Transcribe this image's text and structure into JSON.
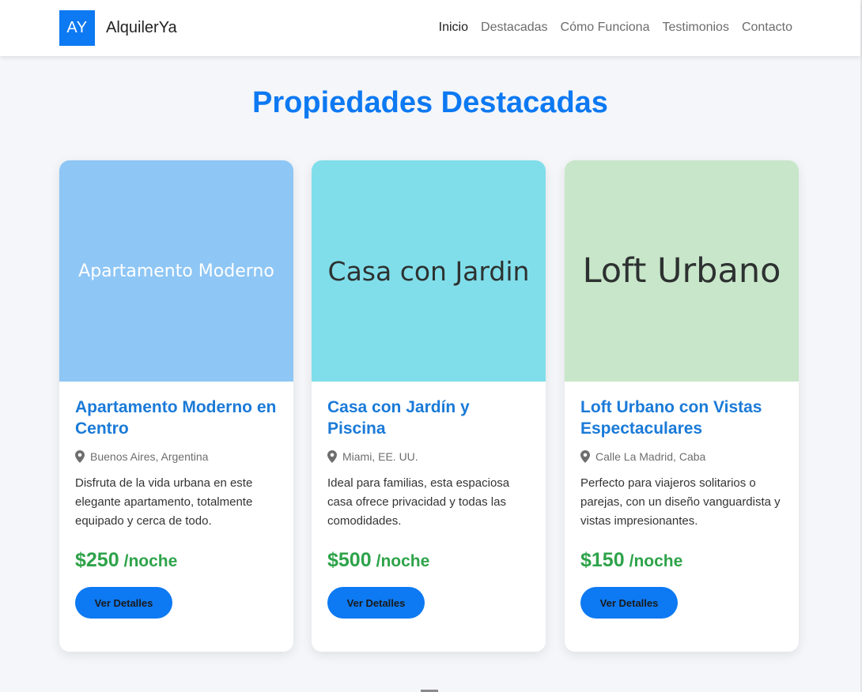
{
  "brand": {
    "logo": "AY",
    "name": "AlquilerYa"
  },
  "nav": {
    "items": [
      {
        "label": "Inicio",
        "active": true
      },
      {
        "label": "Destacadas",
        "active": false
      },
      {
        "label": "Cómo Funciona",
        "active": false
      },
      {
        "label": "Testimonios",
        "active": false
      },
      {
        "label": "Contacto",
        "active": false
      }
    ]
  },
  "section": {
    "title": "Propiedades Destacadas"
  },
  "properties": [
    {
      "image_text": "Apartamento Moderno",
      "image_color": "#8ec6f5",
      "title": "Apartamento Moderno en Centro",
      "location": "Buenos Aires, Argentina",
      "description": "Disfruta de la vida urbana en este elegante apartamento, totalmente equipado y cerca de todo.",
      "price": "$250",
      "price_unit": "/noche",
      "button_label": "Ver Detalles"
    },
    {
      "image_text": "Casa con Jardin",
      "image_color": "#80deea",
      "title": "Casa con Jardín y Piscina",
      "location": "Miami, EE. UU.",
      "description": "Ideal para familias, esta espaciosa casa ofrece privacidad y todas las comodidades.",
      "price": "$500",
      "price_unit": "/noche",
      "button_label": "Ver Detalles"
    },
    {
      "image_text": "Loft Urbano",
      "image_color": "#c8e6c9",
      "title": "Loft Urbano con Vistas Espectaculares",
      "location": "Calle La Madrid, Caba",
      "description": "Perfecto para viajeros solitarios o parejas, con un diseño vanguardista y vistas impresionantes.",
      "price": "$150",
      "price_unit": "/noche",
      "button_label": "Ver Detalles"
    }
  ],
  "colors": {
    "accent": "#0d79f2",
    "title_blue": "#1a7ad8",
    "price_green": "#2ea34a",
    "background": "#f4f6f9"
  },
  "icons": {
    "location": "map-pin-icon"
  }
}
